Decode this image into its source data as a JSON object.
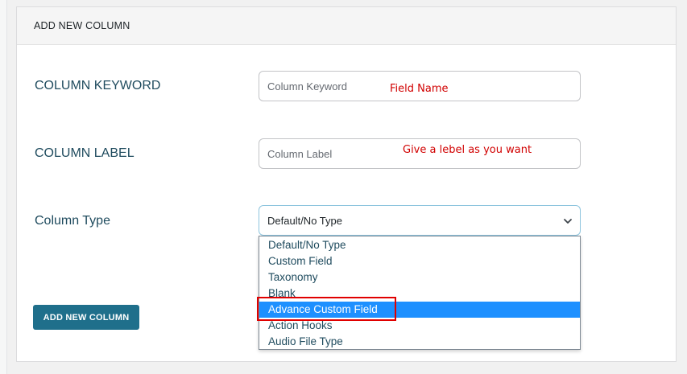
{
  "panel": {
    "title": "ADD NEW COLUMN"
  },
  "fields": {
    "keyword": {
      "label": "COLUMN KEYWORD",
      "placeholder": "Column Keyword",
      "annotation": "Field Name"
    },
    "label": {
      "label": "COLUMN LABEL",
      "placeholder": "Column Label",
      "annotation": "Give a lebel as you want"
    },
    "type": {
      "label": "Column Type",
      "selected_value": "Default/No Type",
      "options": [
        "Default/No Type",
        "Custom Field",
        "Taxonomy",
        "Blank",
        "Advance Custom Field",
        "Action Hooks",
        "Audio File Type"
      ],
      "highlighted_option": "Advance Custom Field"
    }
  },
  "button": {
    "label": "ADD NEW COLUMN"
  },
  "icons": {
    "select_caret": "chevron-down-icon"
  },
  "colors": {
    "label_text": "#1f4b5e",
    "button_bg": "#1f6f8b",
    "option_highlight": "#1e90ff",
    "annotation_red": "#d10000",
    "highlight_border": "#e00000"
  }
}
